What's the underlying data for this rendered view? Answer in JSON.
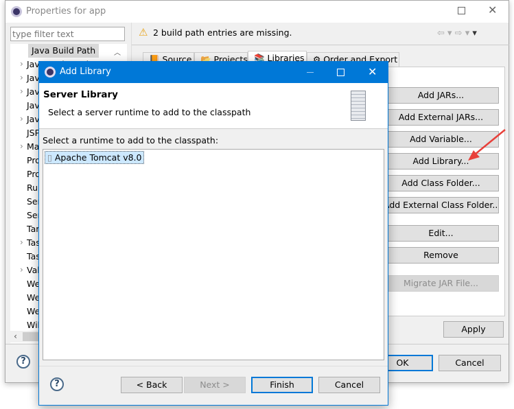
{
  "outer": {
    "title": "Properties for app",
    "filter_placeholder": "type filter text",
    "tree": [
      {
        "label": "Java Build Path",
        "chev": false,
        "sel": true
      },
      {
        "label": "Java Code Style",
        "chev": true
      },
      {
        "label": "Java Compiler",
        "chev": true
      },
      {
        "label": "Java Editor",
        "chev": true
      },
      {
        "label": "Javadoc Location",
        "chev": false
      },
      {
        "label": "JavaScript",
        "chev": true
      },
      {
        "label": "JSP Fragment",
        "chev": false
      },
      {
        "label": "Maven",
        "chev": true
      },
      {
        "label": "Project Facets",
        "chev": false
      },
      {
        "label": "Project References",
        "chev": false
      },
      {
        "label": "Run/Debug Settings",
        "chev": false
      },
      {
        "label": "Server",
        "chev": false
      },
      {
        "label": "Service Policies",
        "chev": false
      },
      {
        "label": "Targeted Runtimes",
        "chev": false
      },
      {
        "label": "Task Repository",
        "chev": true
      },
      {
        "label": "Task Tags",
        "chev": false
      },
      {
        "label": "Validation",
        "chev": true
      },
      {
        "label": "Web Content Settings",
        "chev": false
      },
      {
        "label": "Web Page Editor",
        "chev": false
      },
      {
        "label": "Web Project Settings",
        "chev": false
      },
      {
        "label": "WikiText",
        "chev": false
      }
    ],
    "warning": "2 build path entries are missing.",
    "tabs": [
      "Source",
      "Projects",
      "Libraries",
      "Order and Export"
    ],
    "buttons": [
      "Add JARs...",
      "Add External JARs...",
      "Add Variable...",
      "Add Library...",
      "Add Class Folder...",
      "Add External Class Folder...",
      "Edit...",
      "Remove",
      "Migrate JAR File..."
    ],
    "apply": "Apply",
    "ok": "OK",
    "cancel": "Cancel"
  },
  "dialog": {
    "title": "Add Library",
    "header_title": "Server Library",
    "header_desc": "Select a server runtime to add to the classpath",
    "list_label": "Select a runtime to add to the classpath:",
    "items": [
      "Apache Tomcat v8.0"
    ],
    "back": "< Back",
    "next": "Next >",
    "finish": "Finish",
    "cancel": "Cancel"
  },
  "colors": {
    "accent": "#0078d7",
    "arrow": "#e8403a"
  }
}
